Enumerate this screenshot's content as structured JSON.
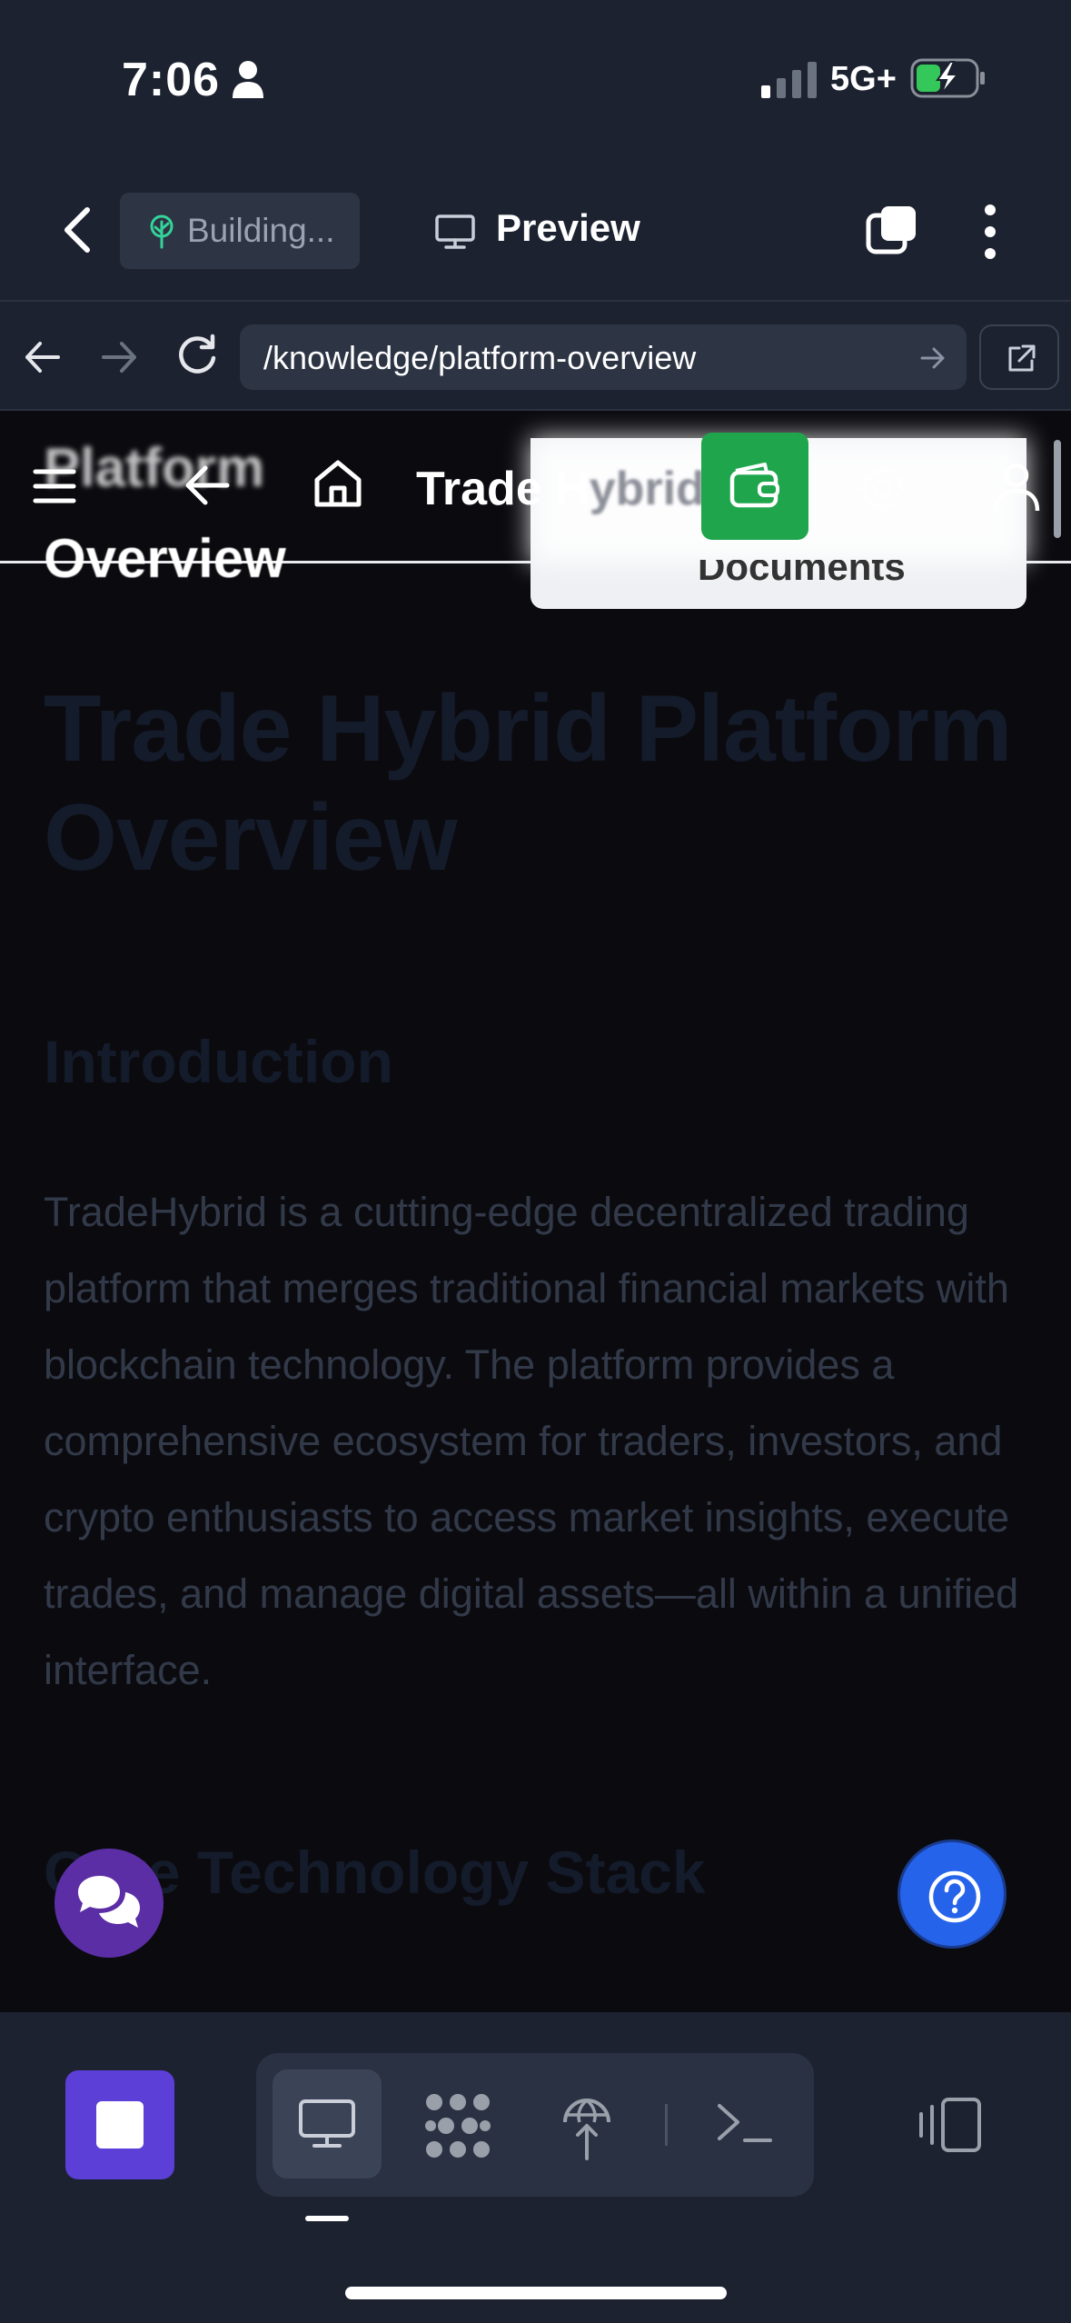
{
  "status_bar": {
    "time": "7:06",
    "network": "5G+",
    "icons": [
      "person-icon",
      "signal-icon",
      "battery-charging-icon"
    ]
  },
  "app_bar": {
    "build_status": "Building...",
    "preview_label": "Preview",
    "icons": [
      "chevron-left-icon",
      "tree-icon",
      "monitor-icon",
      "tabs-icon",
      "more-vertical-icon"
    ]
  },
  "browser": {
    "url": "/knowledge/platform-overview",
    "icons": [
      "arrow-left-icon",
      "arrow-right-icon",
      "reload-icon",
      "go-arrow-icon",
      "external-link-icon"
    ]
  },
  "page_nav": {
    "ghost_title_line1": "Platform",
    "ghost_title_line2": "Overview",
    "brand_visible": "Trade H",
    "brand_faded": "ybrid",
    "dropdown_item": "Documents",
    "accent_green": "#1fa64c",
    "icons": [
      "hamburger-icon",
      "arrow-left-icon",
      "home-icon",
      "wallet-icon",
      "gear-icon",
      "user-icon"
    ]
  },
  "article": {
    "title": "Trade Hybrid Platform Overview",
    "section1_heading": "Introduction",
    "section1_text": "TradeHybrid is a cutting-edge decentralized trading platform that merges traditional financial markets with blockchain technology. The platform provides a comprehensive ecosystem for traders, investors, and crypto enthusiasts to access market insights, execute trades, and manage digital assets—all within a unified interface.",
    "section2_heading": "Core Technology Stack"
  },
  "floating": {
    "chat_color": "#5b2ea6",
    "help_color": "#2563eb",
    "icons": [
      "chat-bubbles-icon",
      "help-circle-icon"
    ]
  },
  "bottom_bar": {
    "stop_color": "#5b3fd6",
    "icons": [
      "stop-icon",
      "monitor-icon",
      "cluster-icon",
      "deploy-globe-icon",
      "terminal-icon",
      "devices-icon"
    ]
  }
}
